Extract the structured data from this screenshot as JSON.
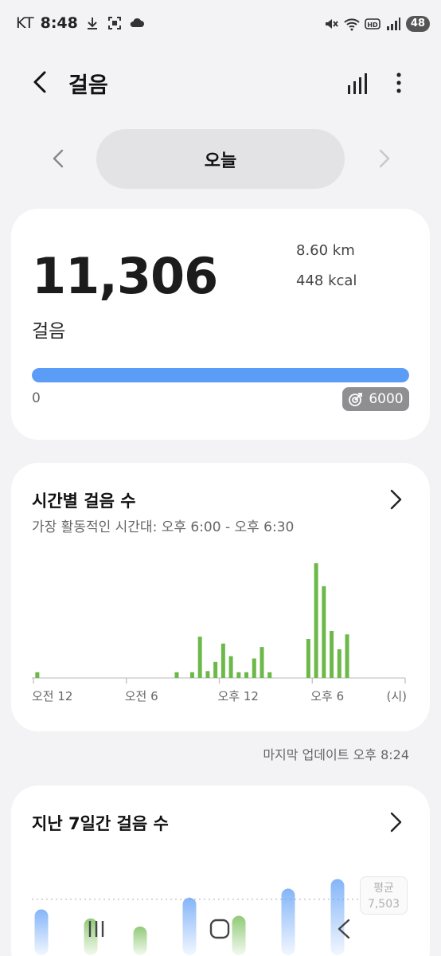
{
  "status_bar": {
    "carrier": "KT",
    "time": "8:48",
    "battery": "48",
    "icons": [
      "download-icon",
      "screenshot-icon",
      "cloud-icon",
      "mute-icon",
      "wifi-icon",
      "hd-icon",
      "signal-icon"
    ]
  },
  "app_bar": {
    "title": "걸음",
    "icons": [
      "back-icon",
      "bar-chart-icon",
      "more-vertical-icon"
    ]
  },
  "date_nav": {
    "label": "오늘"
  },
  "steps_card": {
    "steps": "11,306",
    "unit": "걸음",
    "distance": "8.60  km",
    "calories": "448  kcal",
    "progress_min": "0",
    "goal": "6000",
    "progress_fraction": 1.0,
    "progress_color": "#5b9cf6"
  },
  "hourly_card": {
    "title": "시간별 걸음 수",
    "subtitle": "가장 활동적인 시간대: 오후 6:00 - 오후 6:30"
  },
  "chart_data": {
    "type": "bar",
    "bar_color": "#6cb94a",
    "x_tick_labels": [
      "오전 12",
      "오전 6",
      "오후 12",
      "오후 6"
    ],
    "x_unit_label": "(시)",
    "slots_per_day": 48,
    "bars": [
      {
        "slot": 0,
        "value": 5
      },
      {
        "slot": 18,
        "value": 5
      },
      {
        "slot": 20,
        "value": 5
      },
      {
        "slot": 21,
        "value": 36
      },
      {
        "slot": 22,
        "value": 6
      },
      {
        "slot": 23,
        "value": 14
      },
      {
        "slot": 24,
        "value": 30
      },
      {
        "slot": 25,
        "value": 19
      },
      {
        "slot": 26,
        "value": 5
      },
      {
        "slot": 27,
        "value": 5
      },
      {
        "slot": 28,
        "value": 17
      },
      {
        "slot": 29,
        "value": 27
      },
      {
        "slot": 30,
        "value": 5
      },
      {
        "slot": 35,
        "value": 34
      },
      {
        "slot": 36,
        "value": 100
      },
      {
        "slot": 37,
        "value": 80
      },
      {
        "slot": 38,
        "value": 41
      },
      {
        "slot": 39,
        "value": 25
      },
      {
        "slot": 40,
        "value": 38
      }
    ],
    "ylim": [
      0,
      100
    ]
  },
  "last_update": "마지막 업데이트 오후 8:24",
  "weekly_card": {
    "title": "지난 7일간 걸음 수",
    "avg_label": "평균",
    "avg_value": "7,503"
  },
  "weekly_chart": {
    "type": "bar",
    "avg": 7503,
    "ylim": [
      0,
      13000
    ],
    "days": [
      {
        "value": 5600,
        "color": "#5b9cf6"
      },
      {
        "value": 3900,
        "color": "#6cb94a"
      },
      {
        "value": 2400,
        "color": "#6cb94a"
      },
      {
        "value": 7800,
        "color": "#5b9cf6"
      },
      {
        "value": 4400,
        "color": "#6cb94a"
      },
      {
        "value": 9500,
        "color": "#5b9cf6"
      },
      {
        "value": 11306,
        "color": "#5b9cf6"
      }
    ]
  },
  "nav_bar": {
    "icons": [
      "recent-apps-icon",
      "home-icon",
      "back-icon"
    ]
  }
}
